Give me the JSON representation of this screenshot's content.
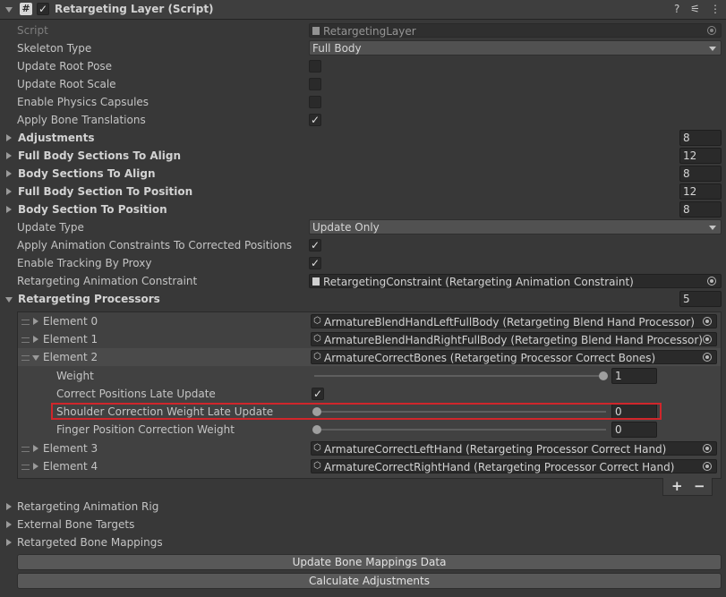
{
  "header": {
    "title": "Retargeting Layer (Script)",
    "enabled": true,
    "help_glyph": "?",
    "settings_glyph": "⚟",
    "menu_glyph": "⋮"
  },
  "fields": {
    "script": {
      "label": "Script",
      "value": "RetargetingLayer"
    },
    "skeleton_type": {
      "label": "Skeleton Type",
      "value": "Full Body"
    },
    "update_root_pose": {
      "label": "Update Root Pose",
      "checked": false
    },
    "update_root_scale": {
      "label": "Update Root Scale",
      "checked": false
    },
    "enable_physics_capsules": {
      "label": "Enable Physics Capsules",
      "checked": false
    },
    "apply_bone_translations": {
      "label": "Apply Bone Translations",
      "checked": true
    },
    "adjustments": {
      "label": "Adjustments",
      "count": "8"
    },
    "full_body_sections_to_align": {
      "label": "Full Body Sections To Align",
      "count": "12"
    },
    "body_sections_to_align": {
      "label": "Body Sections To Align",
      "count": "8"
    },
    "full_body_section_to_position": {
      "label": "Full Body Section To Position",
      "count": "12"
    },
    "body_section_to_position": {
      "label": "Body Section To Position",
      "count": "8"
    },
    "update_type": {
      "label": "Update Type",
      "value": "Update Only"
    },
    "apply_animation_constraints": {
      "label": "Apply Animation Constraints To Corrected Positions",
      "checked": true
    },
    "enable_tracking_by_proxy": {
      "label": "Enable Tracking By Proxy",
      "checked": true
    },
    "retargeting_animation_constraint": {
      "label": "Retargeting Animation Constraint",
      "value": "RetargetingConstraint (Retargeting Animation Constraint)"
    },
    "retargeting_processors": {
      "label": "Retargeting Processors",
      "count": "5"
    }
  },
  "processors": {
    "element0": {
      "label": "Element 0",
      "value": "ArmatureBlendHandLeftFullBody (Retargeting Blend Hand Processor)"
    },
    "element1": {
      "label": "Element 1",
      "value": "ArmatureBlendHandRightFullBody (Retargeting Blend Hand Processor)"
    },
    "element2": {
      "label": "Element 2",
      "value": "ArmatureCorrectBones (Retargeting Processor Correct Bones)",
      "weight": {
        "label": "Weight",
        "value": "1",
        "level": 1.0
      },
      "correct_positions_late_update": {
        "label": "Correct Positions Late Update",
        "checked": true
      },
      "shoulder_correction_weight_late_update": {
        "label": "Shoulder Correction Weight Late Update",
        "value": "0",
        "level": 0.0
      },
      "finger_position_correction_weight": {
        "label": "Finger Position Correction Weight",
        "value": "0",
        "level": 0.0
      }
    },
    "element3": {
      "label": "Element 3",
      "value": "ArmatureCorrectLeftHand (Retargeting Processor Correct Hand)"
    },
    "element4": {
      "label": "Element 4",
      "value": "ArmatureCorrectRightHand (Retargeting Processor Correct Hand)"
    },
    "add_label": "+",
    "remove_label": "−"
  },
  "foldouts": {
    "rig": "Retargeting Animation Rig",
    "external": "External Bone Targets",
    "mappings": "Retargeted Bone Mappings"
  },
  "buttons": {
    "update_mappings": "Update Bone Mappings Data",
    "calculate": "Calculate Adjustments"
  },
  "colors": {
    "highlight": "#d0262b",
    "background": "#383838"
  }
}
